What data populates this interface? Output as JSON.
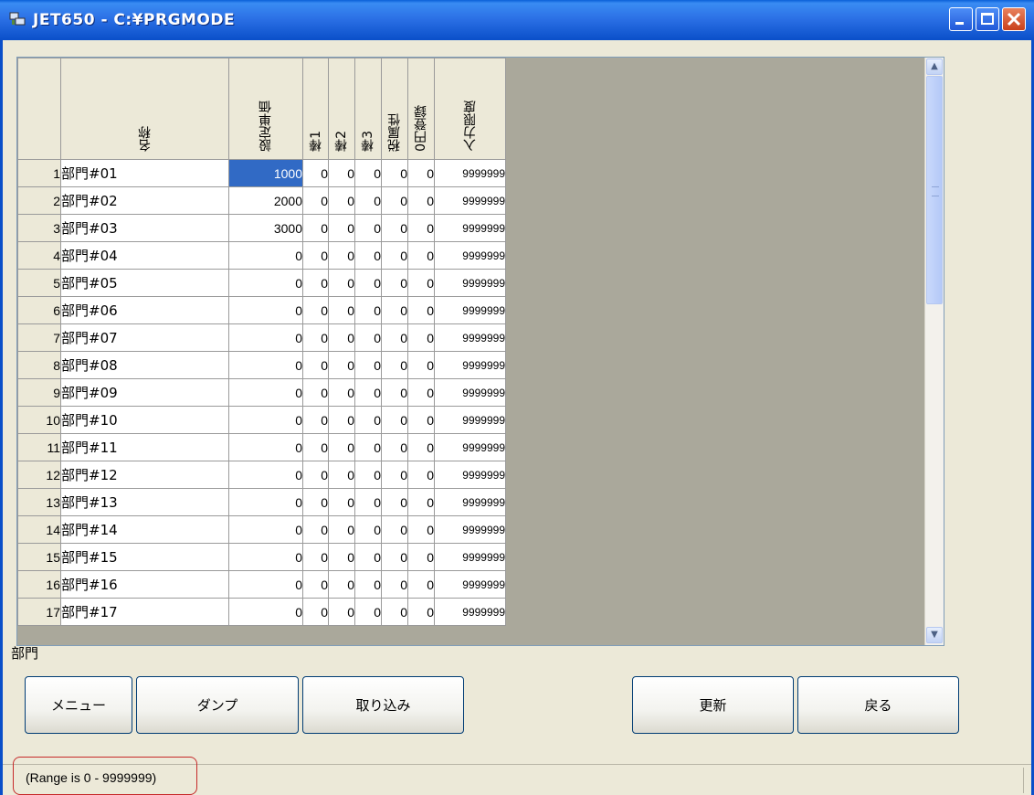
{
  "window": {
    "title": "JET650 - C:¥PRGMODE"
  },
  "grid": {
    "columns": [
      "名称",
      "設定単価",
      "棒1",
      "棒2",
      "棒3",
      "税属性",
      "0円登録",
      "入力限度"
    ],
    "rows": [
      {
        "no": "1",
        "name": "部門#01",
        "price": "1000",
        "a": "0",
        "b": "0",
        "c": "0",
        "tax": "0",
        "zero": "0",
        "limit": "9999999"
      },
      {
        "no": "2",
        "name": "部門#02",
        "price": "2000",
        "a": "0",
        "b": "0",
        "c": "0",
        "tax": "0",
        "zero": "0",
        "limit": "9999999"
      },
      {
        "no": "3",
        "name": "部門#03",
        "price": "3000",
        "a": "0",
        "b": "0",
        "c": "0",
        "tax": "0",
        "zero": "0",
        "limit": "9999999"
      },
      {
        "no": "4",
        "name": "部門#04",
        "price": "0",
        "a": "0",
        "b": "0",
        "c": "0",
        "tax": "0",
        "zero": "0",
        "limit": "9999999"
      },
      {
        "no": "5",
        "name": "部門#05",
        "price": "0",
        "a": "0",
        "b": "0",
        "c": "0",
        "tax": "0",
        "zero": "0",
        "limit": "9999999"
      },
      {
        "no": "6",
        "name": "部門#06",
        "price": "0",
        "a": "0",
        "b": "0",
        "c": "0",
        "tax": "0",
        "zero": "0",
        "limit": "9999999"
      },
      {
        "no": "7",
        "name": "部門#07",
        "price": "0",
        "a": "0",
        "b": "0",
        "c": "0",
        "tax": "0",
        "zero": "0",
        "limit": "9999999"
      },
      {
        "no": "8",
        "name": "部門#08",
        "price": "0",
        "a": "0",
        "b": "0",
        "c": "0",
        "tax": "0",
        "zero": "0",
        "limit": "9999999"
      },
      {
        "no": "9",
        "name": "部門#09",
        "price": "0",
        "a": "0",
        "b": "0",
        "c": "0",
        "tax": "0",
        "zero": "0",
        "limit": "9999999"
      },
      {
        "no": "10",
        "name": "部門#10",
        "price": "0",
        "a": "0",
        "b": "0",
        "c": "0",
        "tax": "0",
        "zero": "0",
        "limit": "9999999"
      },
      {
        "no": "11",
        "name": "部門#11",
        "price": "0",
        "a": "0",
        "b": "0",
        "c": "0",
        "tax": "0",
        "zero": "0",
        "limit": "9999999"
      },
      {
        "no": "12",
        "name": "部門#12",
        "price": "0",
        "a": "0",
        "b": "0",
        "c": "0",
        "tax": "0",
        "zero": "0",
        "limit": "9999999"
      },
      {
        "no": "13",
        "name": "部門#13",
        "price": "0",
        "a": "0",
        "b": "0",
        "c": "0",
        "tax": "0",
        "zero": "0",
        "limit": "9999999"
      },
      {
        "no": "14",
        "name": "部門#14",
        "price": "0",
        "a": "0",
        "b": "0",
        "c": "0",
        "tax": "0",
        "zero": "0",
        "limit": "9999999"
      },
      {
        "no": "15",
        "name": "部門#15",
        "price": "0",
        "a": "0",
        "b": "0",
        "c": "0",
        "tax": "0",
        "zero": "0",
        "limit": "9999999"
      },
      {
        "no": "16",
        "name": "部門#16",
        "price": "0",
        "a": "0",
        "b": "0",
        "c": "0",
        "tax": "0",
        "zero": "0",
        "limit": "9999999"
      },
      {
        "no": "17",
        "name": "部門#17",
        "price": "0",
        "a": "0",
        "b": "0",
        "c": "0",
        "tax": "0",
        "zero": "0",
        "limit": "9999999"
      }
    ],
    "selected_row": 0,
    "selected_col": "price"
  },
  "section_label": "部門",
  "buttons": {
    "menu": "メニュー",
    "dump": "ダンプ",
    "import": "取り込み",
    "update": "更新",
    "back": "戻る"
  },
  "status": {
    "text": "(Range is 0 - 9999999)"
  },
  "colors": {
    "titlebar": "#0a4fc9",
    "selection": "#316ac5",
    "highlight_box": "#c62a2a"
  }
}
